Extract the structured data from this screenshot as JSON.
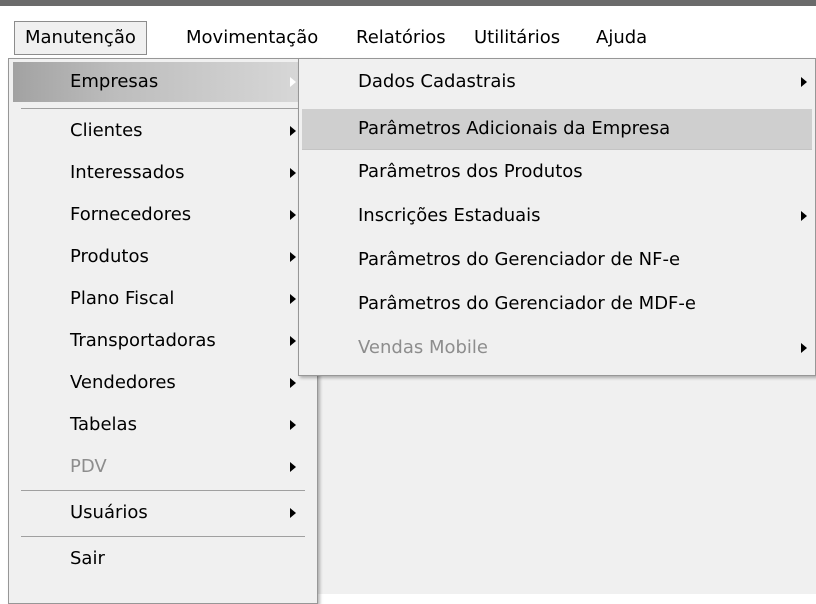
{
  "menubar": {
    "items": [
      {
        "label": "Manutenção"
      },
      {
        "label": "Movimentação"
      },
      {
        "label": "Relatórios"
      },
      {
        "label": "Utilitários"
      },
      {
        "label": "Ajuda"
      }
    ]
  },
  "manutencao_menu": {
    "items": [
      {
        "label": "Empresas",
        "state": "selected",
        "has_submenu": true
      },
      {
        "label": "Clientes",
        "has_submenu": true
      },
      {
        "label": "Interessados",
        "has_submenu": true
      },
      {
        "label": "Fornecedores",
        "has_submenu": true
      },
      {
        "label": "Produtos",
        "has_submenu": true
      },
      {
        "label": "Plano Fiscal",
        "has_submenu": true
      },
      {
        "label": "Transportadoras",
        "has_submenu": true
      },
      {
        "label": "Vendedores",
        "has_submenu": true
      },
      {
        "label": "Tabelas",
        "has_submenu": true
      },
      {
        "label": "PDV",
        "state": "disabled",
        "has_submenu": true
      },
      {
        "label": "Usuários",
        "has_submenu": true
      },
      {
        "label": "Sair",
        "has_submenu": false
      }
    ]
  },
  "empresas_submenu": {
    "items": [
      {
        "label": "Dados Cadastrais",
        "has_submenu": true
      },
      {
        "label": "Parâmetros Adicionais da Empresa",
        "state": "hover",
        "has_submenu": false
      },
      {
        "label": "Parâmetros dos Produtos",
        "has_submenu": false
      },
      {
        "label": "Inscrições Estaduais",
        "has_submenu": true
      },
      {
        "label": "Parâmetros do Gerenciador de NF-e",
        "has_submenu": false
      },
      {
        "label": "Parâmetros do Gerenciador de MDF-e",
        "has_submenu": false
      },
      {
        "label": "Vendas Mobile",
        "state": "disabled",
        "has_submenu": true
      }
    ]
  },
  "colors": {
    "menu_background": "#f0f0f0",
    "hover_highlight": "#cfcfcf",
    "disabled_text": "#8d8d8d",
    "top_strip": "#6b6b6b"
  }
}
